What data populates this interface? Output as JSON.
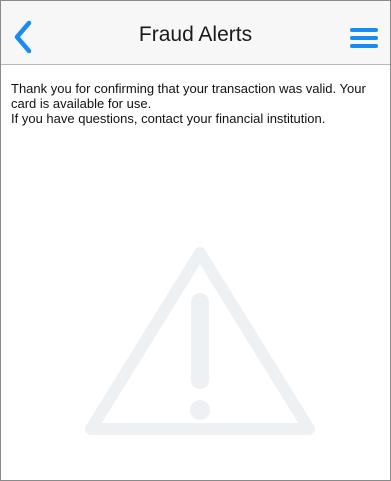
{
  "navbar": {
    "title": "Fraud Alerts",
    "back_icon": "chevron-left-icon",
    "menu_icon": "hamburger-menu-icon"
  },
  "message": {
    "line1": "Thank you for confirming that your transaction was valid. Your card is available for use.",
    "line2": "If you have questions, contact your financial institution."
  },
  "watermark_icon": "warning-triangle-icon",
  "colors": {
    "accent": "#1a8cf0",
    "navbar_bg": "#f7f7f7",
    "watermark": "#eef1f4"
  }
}
